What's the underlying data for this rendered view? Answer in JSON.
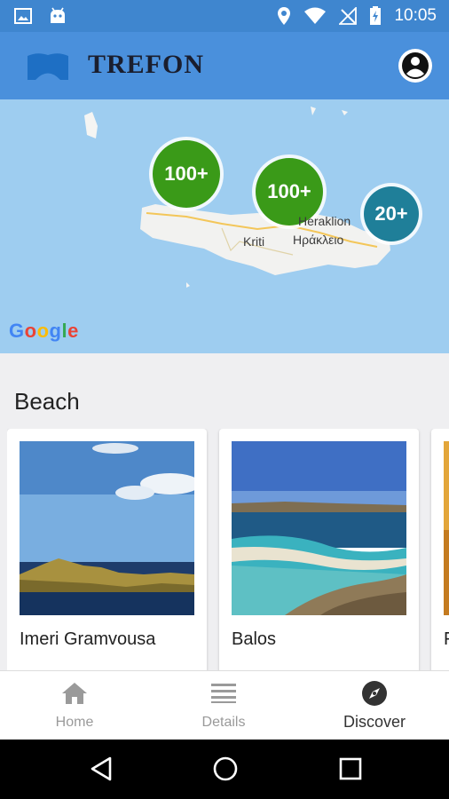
{
  "status_bar": {
    "time": "10:05",
    "left_icons": [
      "image-icon",
      "android-icon"
    ],
    "right_icons": [
      "location-icon",
      "wifi-icon",
      "no-signal-icon",
      "battery-charging-icon"
    ]
  },
  "app_bar": {
    "brand": "TREFON",
    "logo_icon": "trefon-logo-icon",
    "account_icon": "account-circle-icon"
  },
  "map": {
    "clusters": [
      {
        "label": "100+",
        "color": "#3a9a18"
      },
      {
        "label": "100+",
        "color": "#3a9a18"
      },
      {
        "label": "20+",
        "color": "#1f7f99"
      }
    ],
    "labels": {
      "city_en": "Heraklion",
      "city_gr": "Ηράκλειο",
      "island": "Kriti"
    },
    "attribution": "Google"
  },
  "section": {
    "title": "Beach"
  },
  "cards": [
    {
      "name": "Imeri Gramvousa"
    },
    {
      "name": "Balos"
    },
    {
      "name": "F"
    }
  ],
  "bottom_nav": {
    "items": [
      {
        "label": "Home",
        "icon": "home-icon",
        "active": false
      },
      {
        "label": "Details",
        "icon": "list-icon",
        "active": false
      },
      {
        "label": "Discover",
        "icon": "compass-icon",
        "active": true
      }
    ]
  },
  "colors": {
    "app_bar": "#4a90dc",
    "status_bar": "#3f86cf",
    "map_water": "#9ecdf0",
    "cluster_green": "#3a9a18",
    "cluster_teal": "#1f7f99"
  }
}
